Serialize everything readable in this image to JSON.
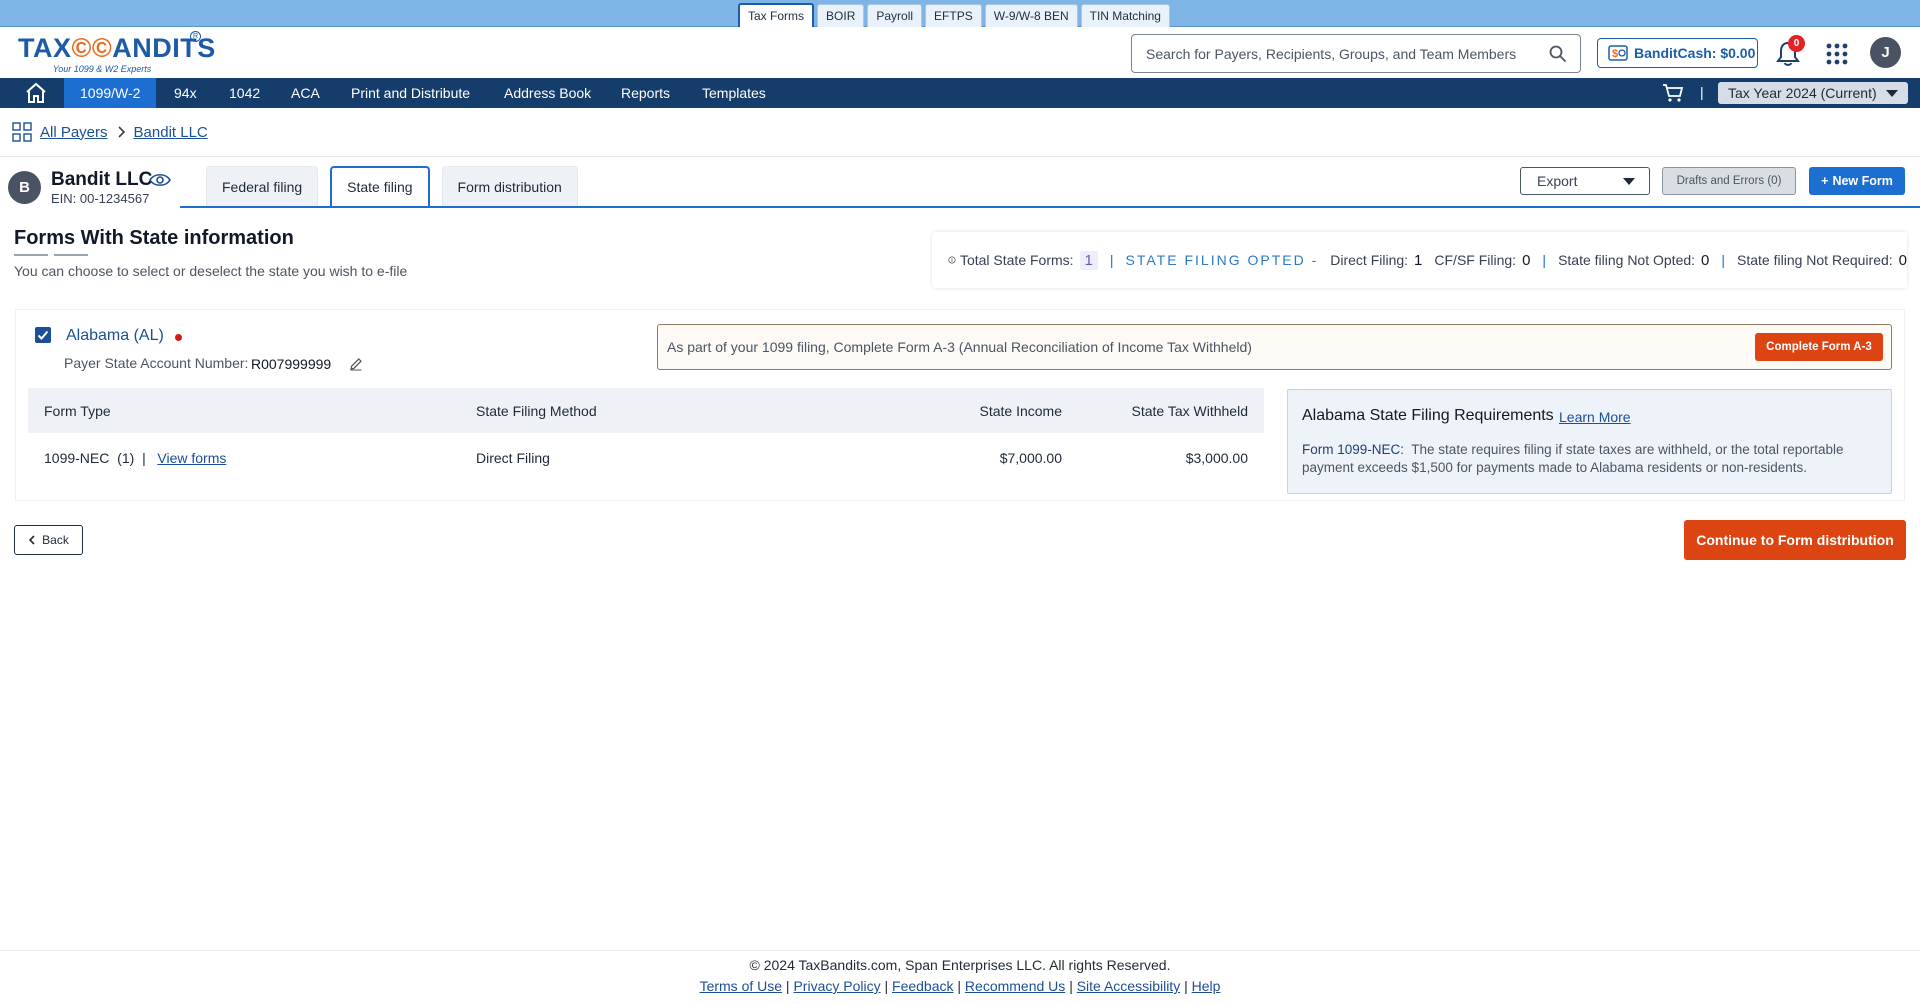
{
  "product_tabs": [
    "Tax Forms",
    "BOIR",
    "Payroll",
    "EFTPS",
    "W-9/W-8 BEN",
    "TIN Matching"
  ],
  "logo": {
    "brand_left": "TAX",
    "brand_mid": "©©",
    "brand_right": "ANDITS",
    "tagline": "Your 1099 & W2 Experts",
    "reg": "R"
  },
  "search": {
    "placeholder": "Search for Payers, Recipients, Groups, and Team Members"
  },
  "banditcash": {
    "label": "BanditCash: $0.00"
  },
  "notifications": {
    "count": "0"
  },
  "user": {
    "initial": "J"
  },
  "nav": {
    "items": [
      "1099/W-2",
      "94x",
      "1042",
      "ACA",
      "Print and Distribute",
      "Address Book",
      "Reports",
      "Templates"
    ],
    "separator": "|",
    "tax_year": "Tax Year 2024 (Current)"
  },
  "breadcrumb": {
    "all_payers": "All Payers",
    "current": "Bandit LLC"
  },
  "payer": {
    "initial": "B",
    "name": "Bandit LLC",
    "ein": "EIN: 00-1234567"
  },
  "filing_tabs": [
    "Federal filing",
    "State filing",
    "Form distribution"
  ],
  "actions": {
    "export": "Export",
    "drafts": "Drafts and Errors (0)",
    "new_form": "New Form"
  },
  "section": {
    "title": "Forms With State information",
    "subtitle": "You can choose to select or deselect the state you wish to e-file"
  },
  "summary": {
    "total_label": "Total State Forms:",
    "total_value": "1",
    "pipe": "|",
    "opted_label": "STATE FILING OPTED -",
    "direct_label": "Direct Filing:",
    "direct_value": "1",
    "cfsf_label": "CF/SF Filing:",
    "cfsf_value": "0",
    "not_opted_label": "State filing Not Opted:",
    "not_opted_value": "0",
    "not_required_label": "State filing Not Required:",
    "not_required_value": "0"
  },
  "state": {
    "name": "Alabama (AL)",
    "account_label": "Payer State Account Number:",
    "account_value": "R007999999",
    "notice": "As part of your 1099 filing, Complete Form A-3 (Annual Reconciliation of Income Tax Withheld)",
    "notice_button": "Complete Form A-3",
    "table": {
      "headers": [
        "Form Type",
        "State Filing Method",
        "State Income",
        "State Tax Withheld"
      ],
      "rows": [
        {
          "form_type": "1099-NEC",
          "count": "(1)",
          "sep": "|",
          "link": "View forms",
          "method": "Direct Filing",
          "income": "$7,000.00",
          "withheld": "$3,000.00"
        }
      ]
    },
    "requirements": {
      "title": "Alabama State Filing Requirements",
      "learn_more": "Learn More",
      "form_label": "Form 1099-NEC:",
      "text": "The state requires filing if state taxes are withheld, or the total reportable payment exceeds $1,500 for payments made to Alabama residents or non-residents."
    }
  },
  "buttons": {
    "back": "Back",
    "continue": "Continue to Form distribution"
  },
  "footer": {
    "copyright": "© 2024 TaxBandits.com, Span Enterprises LLC. All rights Reserved.",
    "links": [
      "Terms of Use",
      "Privacy Policy",
      "Feedback",
      "Recommend Us",
      "Site Accessibility",
      "Help"
    ],
    "sep": "|"
  },
  "colors": {
    "primary": "#1c6fd1",
    "nav_bg": "#153d6b",
    "accent_orange": "#dc4412",
    "top_strip": "#7fb4e6"
  }
}
